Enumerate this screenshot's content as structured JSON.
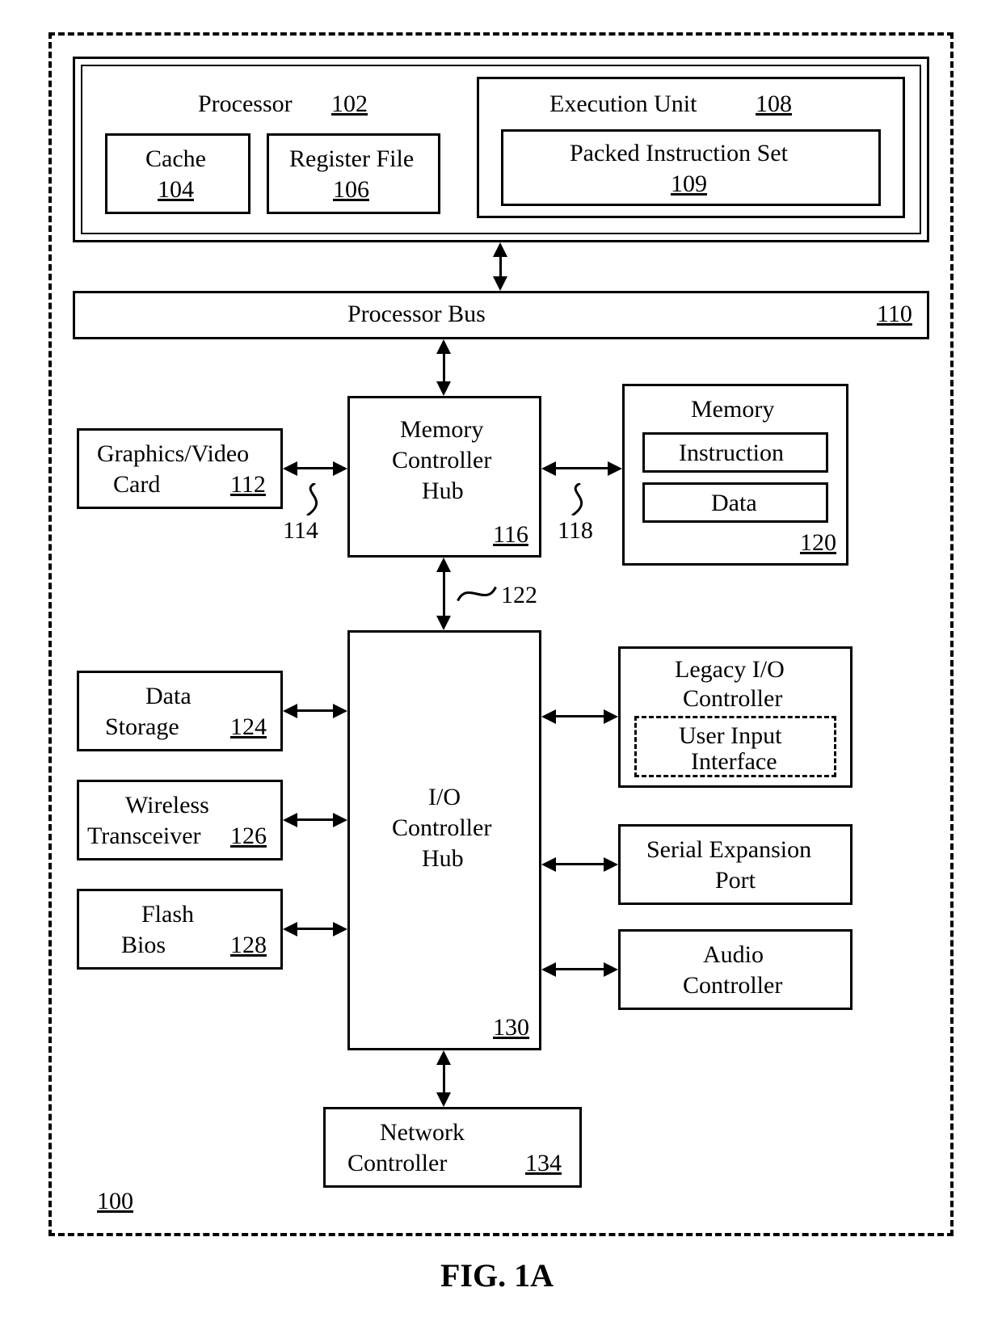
{
  "figure_caption": "FIG. 1A",
  "system_ref": "100",
  "processor": {
    "label": "Processor",
    "ref": "102"
  },
  "cache": {
    "label": "Cache",
    "ref": "104"
  },
  "register_file": {
    "label": "Register File",
    "ref": "106"
  },
  "execution_unit": {
    "label": "Execution Unit",
    "ref": "108"
  },
  "packed_instruction_set": {
    "label": "Packed Instruction Set",
    "ref": "109"
  },
  "processor_bus": {
    "label": "Processor Bus",
    "ref": "110"
  },
  "graphics_card": {
    "label_line1": "Graphics/Video",
    "label_line2": "Card",
    "ref": "112"
  },
  "mch": {
    "label_line1": "Memory",
    "label_line2": "Controller",
    "label_line3": "Hub",
    "ref": "116"
  },
  "memory": {
    "label": "Memory",
    "ref": "120"
  },
  "memory_instruction": {
    "label": "Instruction"
  },
  "memory_data": {
    "label": "Data"
  },
  "conn_114": "114",
  "conn_118": "118",
  "conn_122": "122",
  "ich": {
    "label_line1": "I/O",
    "label_line2": "Controller",
    "label_line3": "Hub",
    "ref": "130"
  },
  "data_storage": {
    "label_line1": "Data",
    "label_line2": "Storage",
    "ref": "124"
  },
  "wireless": {
    "label_line1": "Wireless",
    "label_line2": "Transceiver",
    "ref": "126"
  },
  "flash_bios": {
    "label_line1": "Flash",
    "label_line2": "Bios",
    "ref": "128"
  },
  "legacy_io": {
    "label_line1": "Legacy I/O",
    "label_line2": "Controller"
  },
  "user_input": {
    "label_line1": "User Input",
    "label_line2": "Interface"
  },
  "serial_port": {
    "label_line1": "Serial Expansion",
    "label_line2": "Port"
  },
  "audio": {
    "label_line1": "Audio",
    "label_line2": "Controller"
  },
  "network": {
    "label_line1": "Network",
    "label_line2": "Controller",
    "ref": "134"
  }
}
